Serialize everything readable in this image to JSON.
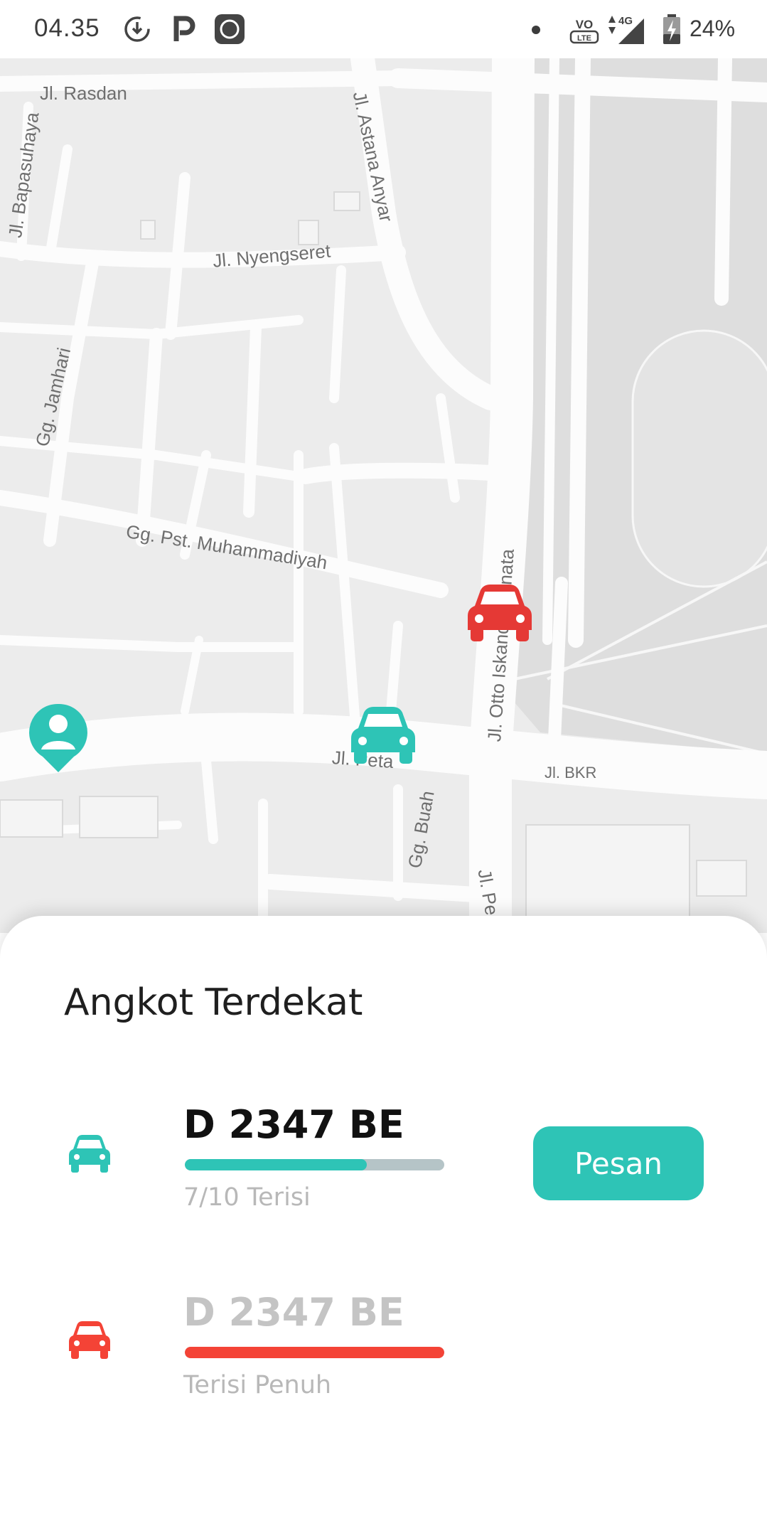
{
  "status_bar": {
    "time": "04.35",
    "network": "4G",
    "battery": "24%",
    "icons": [
      "download-clock-icon",
      "parking-p-icon",
      "mi-app-icon",
      "volte-icon",
      "signal-icon",
      "battery-charging-icon"
    ]
  },
  "map": {
    "streets": {
      "rasdan": "Jl. Rasdan",
      "bapasuhaya": "Jl. Bapasuhaya",
      "astana_anyar": "Jl. Astana Anyar",
      "nyengseret": "Jl. Nyengseret",
      "jamhari": "Gg. Jamhari",
      "muhammadiyah": "Gg. Pst. Muhammadiyah",
      "otto": "Jl. Otto Iskandar Dinata",
      "peta": "Jl. Peta",
      "bkr": "Jl. BKR",
      "buah": "Gg. Buah",
      "pe": "Jl. Pe"
    },
    "markers": {
      "user": "user-location-pin-icon",
      "car_available": "car-icon",
      "car_full": "car-icon"
    }
  },
  "colors": {
    "accent": "#2ec4b6",
    "full": "#f44336",
    "track": "#b5c4c7",
    "muted_text": "#b8b8b8"
  },
  "sheet": {
    "title": "Angkot Terdekat",
    "items": [
      {
        "plate": "D 2347 BE",
        "capacity_label": "7/10 Terisi",
        "filled": 7,
        "capacity": 10,
        "status": "available",
        "action_label": "Pesan"
      },
      {
        "plate": "D 2347 BE",
        "capacity_label": "Terisi Penuh",
        "filled": 10,
        "capacity": 10,
        "status": "full"
      }
    ]
  }
}
